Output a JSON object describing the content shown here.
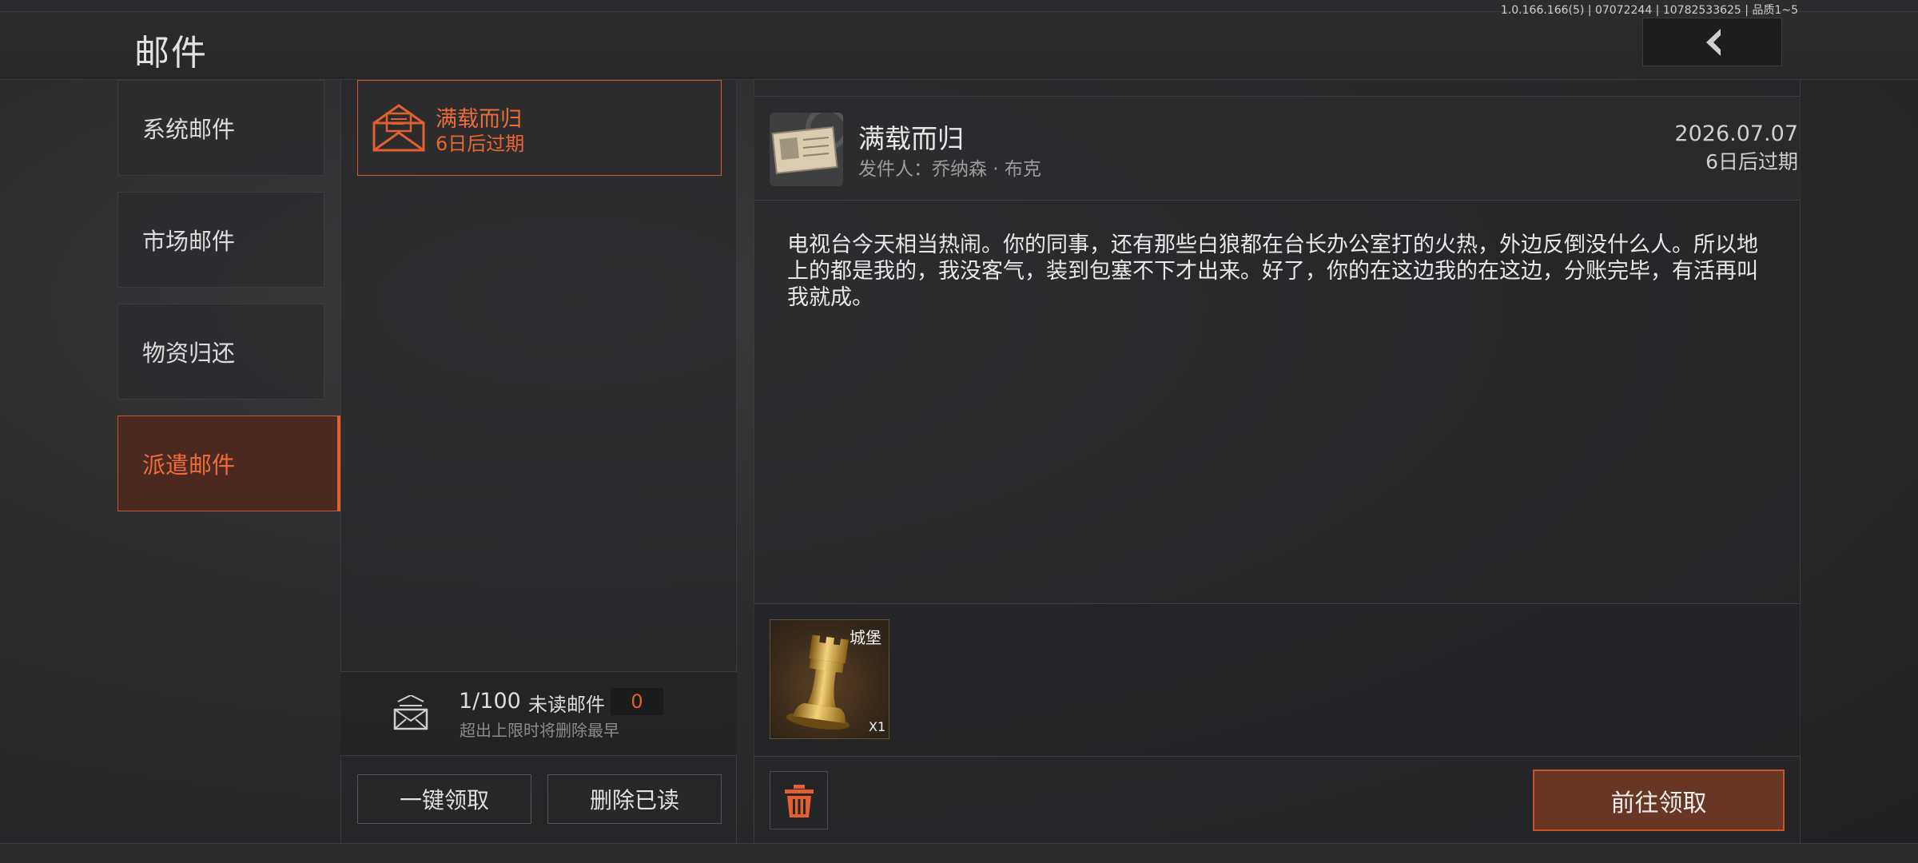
{
  "header": {
    "title": "邮件",
    "version": "1.0.166.166(5) | 07072244 | 10782533625 | 品质1~5"
  },
  "categories": [
    {
      "label": "系统邮件",
      "active": false
    },
    {
      "label": "市场邮件",
      "active": false
    },
    {
      "label": "物资归还",
      "active": false
    },
    {
      "label": "派遣邮件",
      "active": true
    }
  ],
  "mail_list": {
    "items": [
      {
        "title": "满载而归",
        "expire": "6日后过期",
        "selected": true
      }
    ],
    "count": "1/100",
    "unread_label": "未读邮件",
    "unread_count": "0",
    "limit_note": "超出上限时将删除最早",
    "claim_all_label": "一键领取",
    "delete_read_label": "删除已读"
  },
  "detail": {
    "title": "满载而归",
    "sender": "发件人：乔纳森 · 布克",
    "date": "2026.07.07",
    "expire": "6日后过期",
    "body": "电视台今天相当热闹。你的同事，还有那些白狼都在台长办公室打的火热，外边反倒没什么人。所以地上的都是我的，我没客气，装到包塞不下才出来。好了，你的在这边我的在这边，分账完毕，有活再叫我就成。",
    "attachment": {
      "name": "城堡",
      "quantity": "X1",
      "icon": "rook-chess-piece-icon"
    },
    "claim_button_label": "前往领取"
  },
  "colors": {
    "accent": "#e2602f",
    "accent_dark": "#6a3624",
    "background": "#2a2b2d"
  },
  "icons": {
    "back": "chevron-left-icon",
    "mail_item": "open-envelope-icon",
    "stats": "mail-stack-icon",
    "trash": "trash-icon"
  }
}
